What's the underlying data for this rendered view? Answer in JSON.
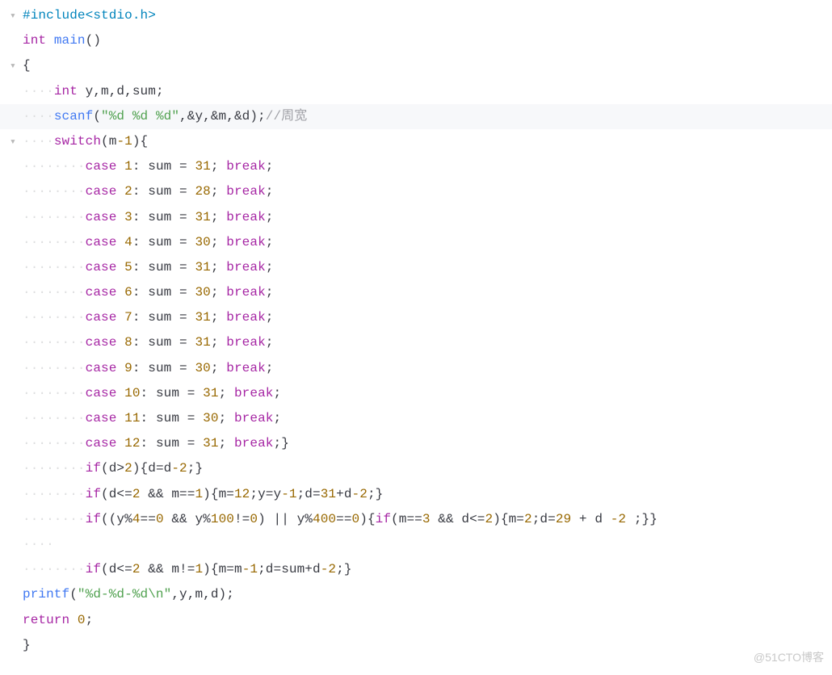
{
  "lines": [
    {
      "gutter": "▾",
      "indent": 0,
      "tokens": [
        {
          "t": "#include<stdio.h>",
          "c": "c-preproc"
        }
      ]
    },
    {
      "gutter": "",
      "indent": 0,
      "tokens": [
        {
          "t": "int ",
          "c": "c-keyword"
        },
        {
          "t": "main",
          "c": "c-func"
        },
        {
          "t": "()",
          "c": "c-op"
        }
      ]
    },
    {
      "gutter": "▾",
      "indent": 0,
      "tokens": [
        {
          "t": "{",
          "c": "c-op"
        }
      ]
    },
    {
      "gutter": "",
      "indent": 1,
      "tokens": [
        {
          "t": "int ",
          "c": "c-keyword"
        },
        {
          "t": "y,m,d,sum;",
          "c": "c-op"
        }
      ]
    },
    {
      "gutter": "",
      "indent": 1,
      "hl": true,
      "tokens": [
        {
          "t": "scanf",
          "c": "c-func"
        },
        {
          "t": "(",
          "c": "c-op"
        },
        {
          "t": "\"%d %d %d\"",
          "c": "c-string"
        },
        {
          "t": ",&y,&m,&d);",
          "c": "c-op"
        },
        {
          "t": "//周宽",
          "c": "c-comment"
        }
      ]
    },
    {
      "gutter": "▾",
      "indent": 1,
      "tokens": [
        {
          "t": "switch",
          "c": "c-keyword"
        },
        {
          "t": "(m",
          "c": "c-op"
        },
        {
          "t": "-1",
          "c": "c-num"
        },
        {
          "t": "){",
          "c": "c-op"
        }
      ]
    },
    {
      "gutter": "",
      "indent": 2,
      "tokens": [
        {
          "t": "case ",
          "c": "c-keyword"
        },
        {
          "t": "1",
          "c": "c-num"
        },
        {
          "t": ": sum = ",
          "c": "c-op"
        },
        {
          "t": "31",
          "c": "c-num"
        },
        {
          "t": "; ",
          "c": "c-op"
        },
        {
          "t": "break",
          "c": "c-keyword"
        },
        {
          "t": ";",
          "c": "c-op"
        }
      ]
    },
    {
      "gutter": "",
      "indent": 2,
      "tokens": [
        {
          "t": "case ",
          "c": "c-keyword"
        },
        {
          "t": "2",
          "c": "c-num"
        },
        {
          "t": ": sum = ",
          "c": "c-op"
        },
        {
          "t": "28",
          "c": "c-num"
        },
        {
          "t": "; ",
          "c": "c-op"
        },
        {
          "t": "break",
          "c": "c-keyword"
        },
        {
          "t": ";",
          "c": "c-op"
        }
      ]
    },
    {
      "gutter": "",
      "indent": 2,
      "tokens": [
        {
          "t": "case ",
          "c": "c-keyword"
        },
        {
          "t": "3",
          "c": "c-num"
        },
        {
          "t": ": sum = ",
          "c": "c-op"
        },
        {
          "t": "31",
          "c": "c-num"
        },
        {
          "t": "; ",
          "c": "c-op"
        },
        {
          "t": "break",
          "c": "c-keyword"
        },
        {
          "t": ";",
          "c": "c-op"
        }
      ]
    },
    {
      "gutter": "",
      "indent": 2,
      "tokens": [
        {
          "t": "case ",
          "c": "c-keyword"
        },
        {
          "t": "4",
          "c": "c-num"
        },
        {
          "t": ": sum = ",
          "c": "c-op"
        },
        {
          "t": "30",
          "c": "c-num"
        },
        {
          "t": "; ",
          "c": "c-op"
        },
        {
          "t": "break",
          "c": "c-keyword"
        },
        {
          "t": ";",
          "c": "c-op"
        }
      ]
    },
    {
      "gutter": "",
      "indent": 2,
      "tokens": [
        {
          "t": "case ",
          "c": "c-keyword"
        },
        {
          "t": "5",
          "c": "c-num"
        },
        {
          "t": ": sum = ",
          "c": "c-op"
        },
        {
          "t": "31",
          "c": "c-num"
        },
        {
          "t": "; ",
          "c": "c-op"
        },
        {
          "t": "break",
          "c": "c-keyword"
        },
        {
          "t": ";",
          "c": "c-op"
        }
      ]
    },
    {
      "gutter": "",
      "indent": 2,
      "tokens": [
        {
          "t": "case ",
          "c": "c-keyword"
        },
        {
          "t": "6",
          "c": "c-num"
        },
        {
          "t": ": sum = ",
          "c": "c-op"
        },
        {
          "t": "30",
          "c": "c-num"
        },
        {
          "t": "; ",
          "c": "c-op"
        },
        {
          "t": "break",
          "c": "c-keyword"
        },
        {
          "t": ";",
          "c": "c-op"
        }
      ]
    },
    {
      "gutter": "",
      "indent": 2,
      "tokens": [
        {
          "t": "case ",
          "c": "c-keyword"
        },
        {
          "t": "7",
          "c": "c-num"
        },
        {
          "t": ": sum = ",
          "c": "c-op"
        },
        {
          "t": "31",
          "c": "c-num"
        },
        {
          "t": "; ",
          "c": "c-op"
        },
        {
          "t": "break",
          "c": "c-keyword"
        },
        {
          "t": ";",
          "c": "c-op"
        }
      ]
    },
    {
      "gutter": "",
      "indent": 2,
      "tokens": [
        {
          "t": "case ",
          "c": "c-keyword"
        },
        {
          "t": "8",
          "c": "c-num"
        },
        {
          "t": ": sum = ",
          "c": "c-op"
        },
        {
          "t": "31",
          "c": "c-num"
        },
        {
          "t": "; ",
          "c": "c-op"
        },
        {
          "t": "break",
          "c": "c-keyword"
        },
        {
          "t": ";",
          "c": "c-op"
        }
      ]
    },
    {
      "gutter": "",
      "indent": 2,
      "tokens": [
        {
          "t": "case ",
          "c": "c-keyword"
        },
        {
          "t": "9",
          "c": "c-num"
        },
        {
          "t": ": sum = ",
          "c": "c-op"
        },
        {
          "t": "30",
          "c": "c-num"
        },
        {
          "t": "; ",
          "c": "c-op"
        },
        {
          "t": "break",
          "c": "c-keyword"
        },
        {
          "t": ";",
          "c": "c-op"
        }
      ]
    },
    {
      "gutter": "",
      "indent": 2,
      "tokens": [
        {
          "t": "case ",
          "c": "c-keyword"
        },
        {
          "t": "10",
          "c": "c-num"
        },
        {
          "t": ": sum = ",
          "c": "c-op"
        },
        {
          "t": "31",
          "c": "c-num"
        },
        {
          "t": "; ",
          "c": "c-op"
        },
        {
          "t": "break",
          "c": "c-keyword"
        },
        {
          "t": ";",
          "c": "c-op"
        }
      ]
    },
    {
      "gutter": "",
      "indent": 2,
      "tokens": [
        {
          "t": "case ",
          "c": "c-keyword"
        },
        {
          "t": "11",
          "c": "c-num"
        },
        {
          "t": ": sum = ",
          "c": "c-op"
        },
        {
          "t": "30",
          "c": "c-num"
        },
        {
          "t": "; ",
          "c": "c-op"
        },
        {
          "t": "break",
          "c": "c-keyword"
        },
        {
          "t": ";",
          "c": "c-op"
        }
      ]
    },
    {
      "gutter": "",
      "indent": 2,
      "tokens": [
        {
          "t": "case ",
          "c": "c-keyword"
        },
        {
          "t": "12",
          "c": "c-num"
        },
        {
          "t": ": sum = ",
          "c": "c-op"
        },
        {
          "t": "31",
          "c": "c-num"
        },
        {
          "t": "; ",
          "c": "c-op"
        },
        {
          "t": "break",
          "c": "c-keyword"
        },
        {
          "t": ";}",
          "c": "c-op"
        }
      ]
    },
    {
      "gutter": "",
      "indent": 2,
      "tokens": [
        {
          "t": "if",
          "c": "c-keyword"
        },
        {
          "t": "(d>",
          "c": "c-op"
        },
        {
          "t": "2",
          "c": "c-num"
        },
        {
          "t": "){d=d",
          "c": "c-op"
        },
        {
          "t": "-2",
          "c": "c-num"
        },
        {
          "t": ";}",
          "c": "c-op"
        }
      ]
    },
    {
      "gutter": "",
      "indent": 2,
      "tokens": [
        {
          "t": "if",
          "c": "c-keyword"
        },
        {
          "t": "(d<=",
          "c": "c-op"
        },
        {
          "t": "2",
          "c": "c-num"
        },
        {
          "t": " && m==",
          "c": "c-op"
        },
        {
          "t": "1",
          "c": "c-num"
        },
        {
          "t": "){m=",
          "c": "c-op"
        },
        {
          "t": "12",
          "c": "c-num"
        },
        {
          "t": ";y=y",
          "c": "c-op"
        },
        {
          "t": "-1",
          "c": "c-num"
        },
        {
          "t": ";d=",
          "c": "c-op"
        },
        {
          "t": "31",
          "c": "c-num"
        },
        {
          "t": "+d",
          "c": "c-op"
        },
        {
          "t": "-2",
          "c": "c-num"
        },
        {
          "t": ";}",
          "c": "c-op"
        }
      ]
    },
    {
      "gutter": "",
      "indent": 2,
      "tokens": [
        {
          "t": "if",
          "c": "c-keyword"
        },
        {
          "t": "((y%",
          "c": "c-op"
        },
        {
          "t": "4",
          "c": "c-num"
        },
        {
          "t": "==",
          "c": "c-op"
        },
        {
          "t": "0",
          "c": "c-num"
        },
        {
          "t": " && y%",
          "c": "c-op"
        },
        {
          "t": "100",
          "c": "c-num"
        },
        {
          "t": "!=",
          "c": "c-op"
        },
        {
          "t": "0",
          "c": "c-num"
        },
        {
          "t": ") || y%",
          "c": "c-op"
        },
        {
          "t": "400",
          "c": "c-num"
        },
        {
          "t": "==",
          "c": "c-op"
        },
        {
          "t": "0",
          "c": "c-num"
        },
        {
          "t": "){",
          "c": "c-op"
        },
        {
          "t": "if",
          "c": "c-keyword"
        },
        {
          "t": "(m==",
          "c": "c-op"
        },
        {
          "t": "3",
          "c": "c-num"
        },
        {
          "t": " && d<=",
          "c": "c-op"
        },
        {
          "t": "2",
          "c": "c-num"
        },
        {
          "t": "){m=",
          "c": "c-op"
        },
        {
          "t": "2",
          "c": "c-num"
        },
        {
          "t": ";d=",
          "c": "c-op"
        },
        {
          "t": "29",
          "c": "c-num"
        },
        {
          "t": " + d ",
          "c": "c-op"
        },
        {
          "t": "-2",
          "c": "c-num"
        },
        {
          "t": " ;}}",
          "c": "c-op"
        }
      ]
    },
    {
      "gutter": "",
      "indent": 1,
      "tokens": [
        {
          "t": "",
          "c": "c-op"
        }
      ]
    },
    {
      "gutter": "",
      "indent": 2,
      "tokens": [
        {
          "t": "if",
          "c": "c-keyword"
        },
        {
          "t": "(d<=",
          "c": "c-op"
        },
        {
          "t": "2",
          "c": "c-num"
        },
        {
          "t": " && m!=",
          "c": "c-op"
        },
        {
          "t": "1",
          "c": "c-num"
        },
        {
          "t": "){m=m",
          "c": "c-op"
        },
        {
          "t": "-1",
          "c": "c-num"
        },
        {
          "t": ";d=sum+d",
          "c": "c-op"
        },
        {
          "t": "-2",
          "c": "c-num"
        },
        {
          "t": ";}",
          "c": "c-op"
        }
      ]
    },
    {
      "gutter": "",
      "indent": 0,
      "tokens": [
        {
          "t": "printf",
          "c": "c-func"
        },
        {
          "t": "(",
          "c": "c-op"
        },
        {
          "t": "\"%d-%d-%d\\n\"",
          "c": "c-string"
        },
        {
          "t": ",y,m,d);",
          "c": "c-op"
        }
      ]
    },
    {
      "gutter": "",
      "indent": 0,
      "tokens": [
        {
          "t": "return ",
          "c": "c-keyword"
        },
        {
          "t": "0",
          "c": "c-num"
        },
        {
          "t": ";",
          "c": "c-op"
        }
      ]
    },
    {
      "gutter": "",
      "indent": 0,
      "tokens": [
        {
          "t": "}",
          "c": "c-op"
        }
      ]
    }
  ],
  "dots_per_indent": "····",
  "watermark": "@51CTO博客"
}
